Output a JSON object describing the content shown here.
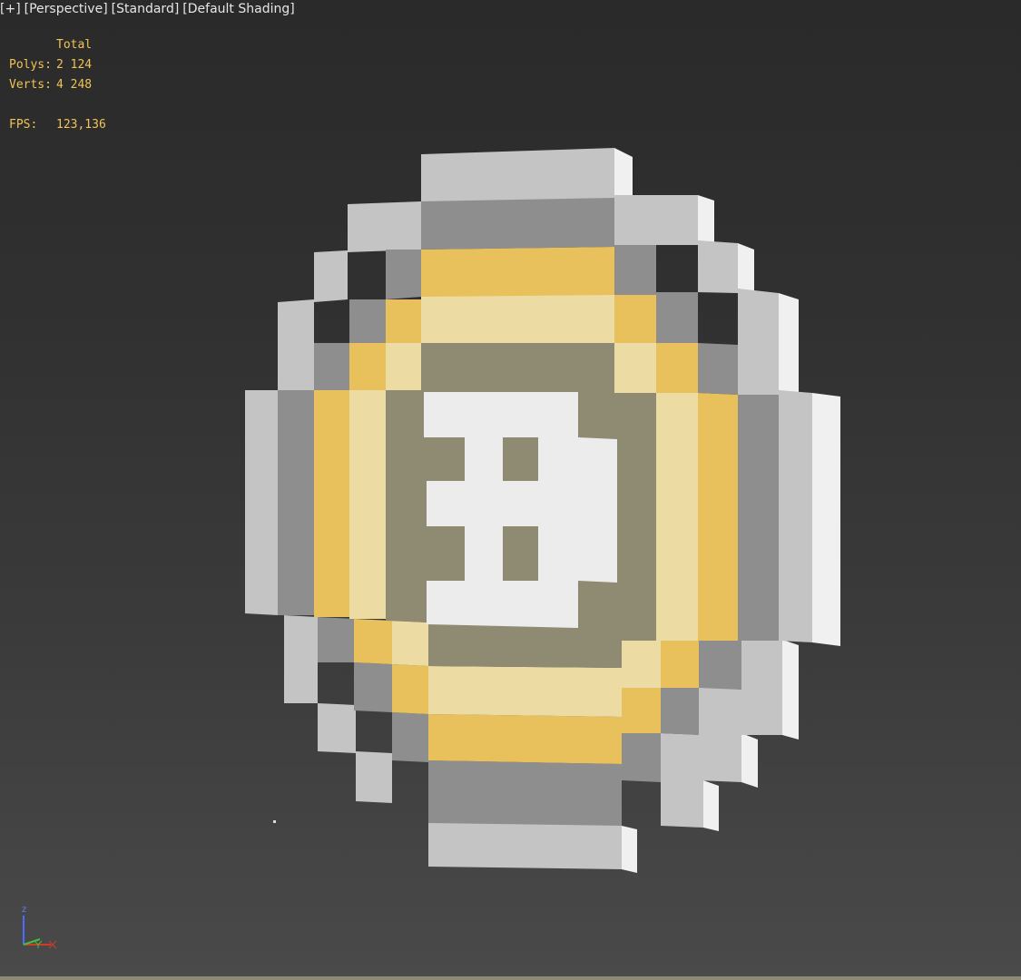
{
  "viewport_menu": {
    "plus": "[+]",
    "view": "[Perspective]",
    "mode": "[Standard]",
    "shading": "[Default Shading]"
  },
  "stats": {
    "header": "Total",
    "polys_label": "Polys:",
    "polys_value": "2 124",
    "verts_label": "Verts:",
    "verts_value": "4 248",
    "fps_label": "FPS:",
    "fps_value": "123,136"
  },
  "axis_gizmo": {
    "z_label": "z",
    "x_color": "#d23a2a",
    "y_color": "#3fbf3f",
    "z_color": "#4a6cff"
  },
  "colors": {
    "stats_text": "#f1c453",
    "coin_gold": "#e8c15c",
    "coin_light_gold": "#ecdba2",
    "coin_taupe": "#8f8a72",
    "coin_white": "#ececec",
    "coin_silver": "#c4c4c4",
    "coin_dark_silver": "#8e8e8e"
  }
}
